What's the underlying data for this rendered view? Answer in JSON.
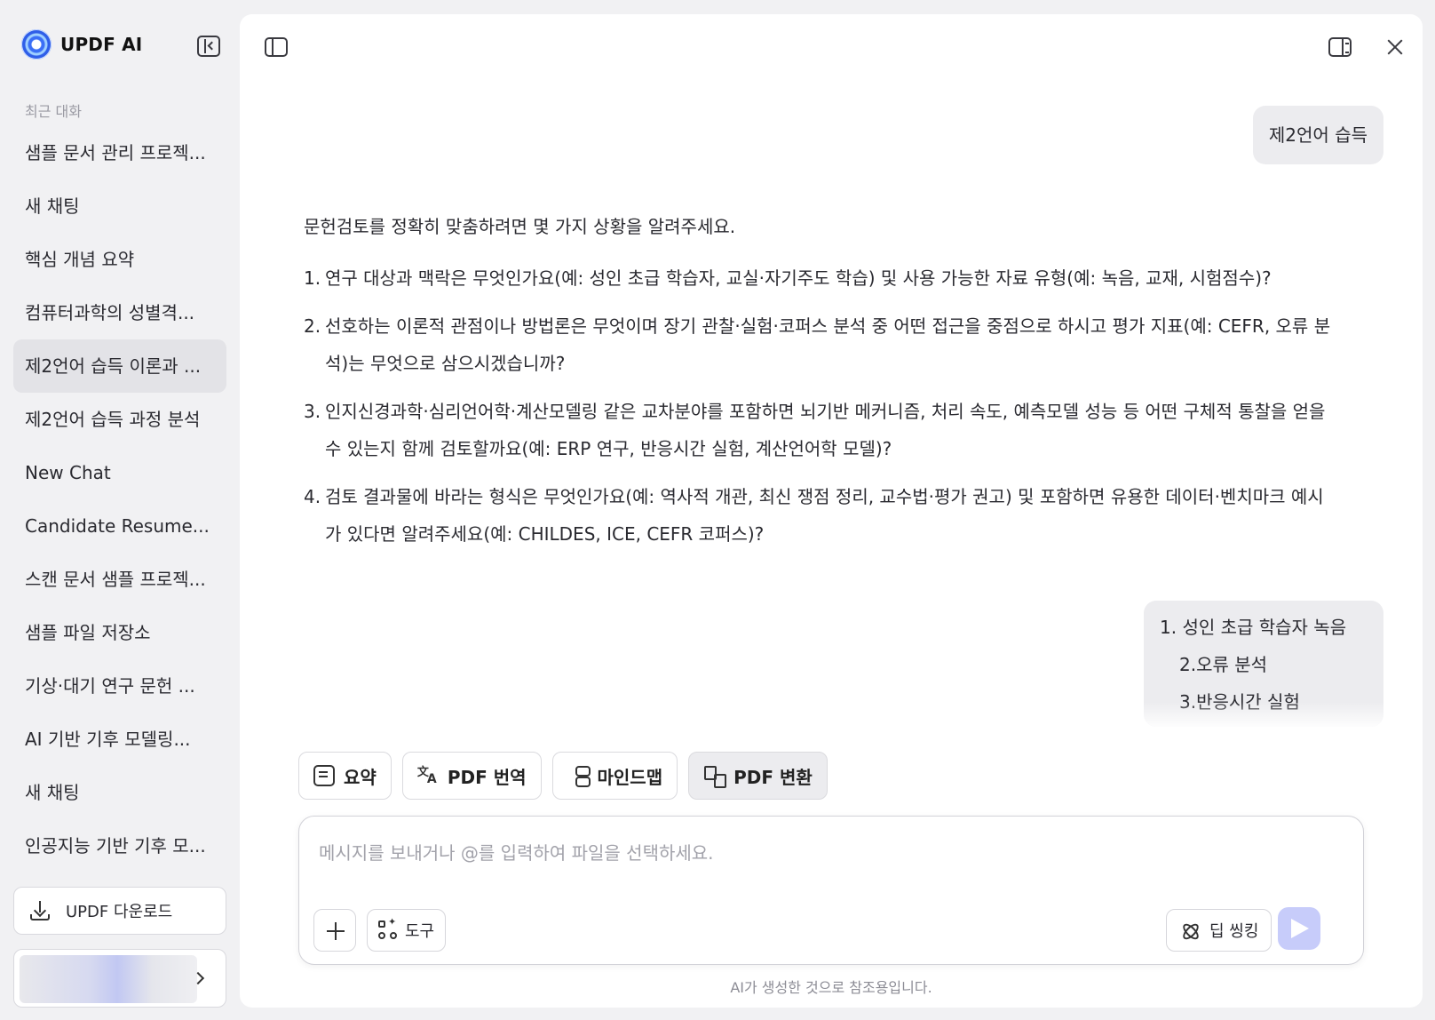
{
  "sidebar": {
    "brand": "UPDF AI",
    "section_label": "최근 대화",
    "items": [
      {
        "label": "샘플 문서 관리 프로젝..."
      },
      {
        "label": "새 채팅"
      },
      {
        "label": "핵심 개념 요약"
      },
      {
        "label": "컴퓨터과학의 성별격..."
      },
      {
        "label": "제2언어 습득 이론과 ...",
        "active": true
      },
      {
        "label": "제2언어 습득 과정 분석"
      },
      {
        "label": "New Chat"
      },
      {
        "label": "Candidate Resume..."
      },
      {
        "label": "스캔 문서 샘플 프로젝..."
      },
      {
        "label": "샘플 파일 저장소"
      },
      {
        "label": "기상·대기 연구 문헌 ..."
      },
      {
        "label": "AI 기반 기후 모델링..."
      },
      {
        "label": "새 채팅"
      },
      {
        "label": "인공지능 기반 기후 모..."
      }
    ],
    "download_label": "UPDF 다운로드"
  },
  "chat": {
    "user_message_1": "제2언어 습득",
    "assistant": {
      "intro": "문헌검토를 정확히 맞춤하려면 몇 가지 상황을 알려주세요.",
      "items": [
        {
          "num": "1.",
          "text": "연구 대상과 맥락은 무엇인가요(예: 성인 초급 학습자, 교실·자기주도 학습) 및 사용 가능한 자료 유형(예: 녹음, 교재, 시험점수)?"
        },
        {
          "num": "2.",
          "text": "선호하는 이론적 관점이나 방법론은 무엇이며 장기 관찰·실험·코퍼스 분석 중 어떤 접근을 중점으로 하시고 평가 지표(예: CEFR, 오류 분석)는 무엇으로 삼으시겠습니까?"
        },
        {
          "num": "3.",
          "text": "인지신경과학·심리언어학·계산모델링 같은 교차분야를 포함하면 뇌기반 메커니즘, 처리 속도, 예측모델 성능 등 어떤 구체적 통찰을 얻을 수 있는지 함께 검토할까요(예: ERP 연구, 반응시간 실험, 계산언어학 모델)?"
        },
        {
          "num": "4.",
          "text": "검토 결과물에 바라는 형식은 무엇인가요(예: 역사적 개관, 최신 쟁점 정리, 교수법·평가 권고) 및 포함하면 유용한 데이터·벤치마크 예시가 있다면 알려주세요(예: CHILDES, ICE, CEFR 코퍼스)?"
        }
      ]
    },
    "user_message_2": {
      "line1": "1. 성인 초급 학습자 녹음",
      "line2": "2.오류 분석",
      "line3": "3.반응시간 실험"
    }
  },
  "quick_tools": {
    "summary": "요약",
    "translate": "PDF 번역",
    "mindmap": "마인드맵",
    "convert": "PDF 변환"
  },
  "composer": {
    "placeholder": "메시지를 보내거나 @를 입력하여 파일을 선택하세요.",
    "value": "",
    "tools_label": "도구",
    "deep_thinking_label": "딥 씽킹"
  },
  "disclaimer": "AI가 생성한 것으로 참조용입니다.",
  "colors": {
    "background": "#f1f1f3",
    "panel": "#ffffff",
    "accent": "#c7ccfa",
    "active_item": "#e3e3e7"
  }
}
